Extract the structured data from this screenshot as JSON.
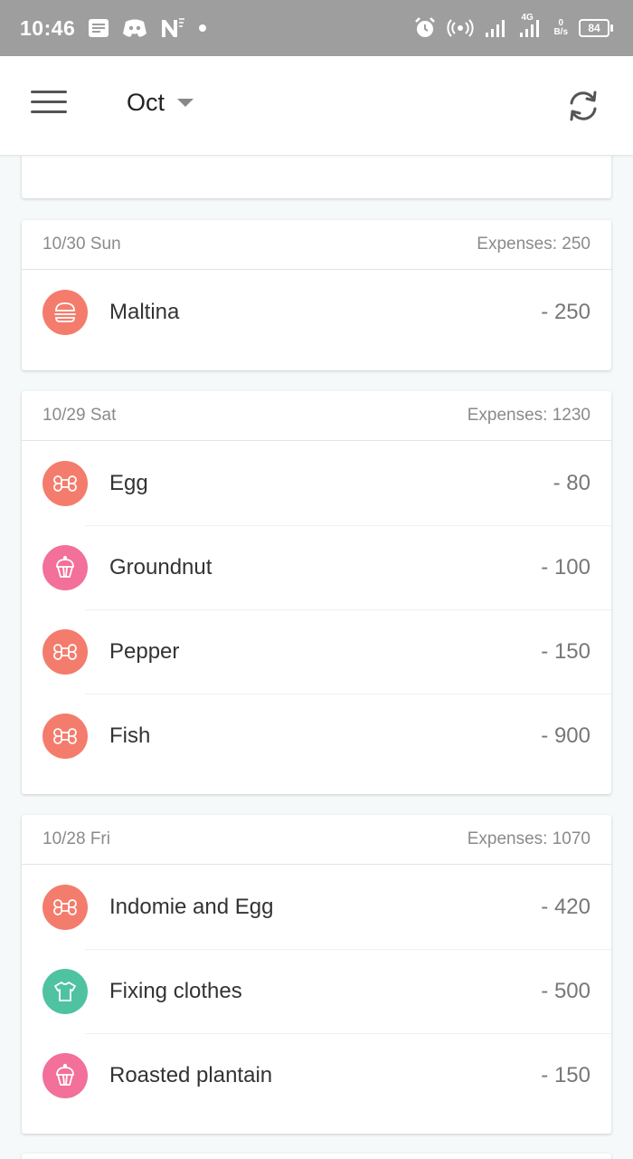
{
  "status_bar": {
    "time": "10:46",
    "network": "4G",
    "speed_value": "0",
    "speed_unit": "B/s",
    "battery": "84",
    "icons": [
      "notes-icon",
      "discord-icon",
      "n-app-icon",
      "dot-icon",
      "alarm-icon",
      "hotspot-icon",
      "signal-icon",
      "signal-4g-icon"
    ]
  },
  "header": {
    "month": "Oct",
    "menu_icon": "hamburger-menu-icon",
    "refresh_icon": "refresh-icon"
  },
  "colors": {
    "food": "#f47c6c",
    "snack": "#f2709a",
    "clothing": "#4fc3a1"
  },
  "days": [
    {
      "date": "10/30 Sun",
      "total": "Expenses: 250",
      "items": [
        {
          "name": "Maltina",
          "amount": "- 250",
          "icon": "burger-icon"
        }
      ]
    },
    {
      "date": "10/29 Sat",
      "total": "Expenses: 1230",
      "items": [
        {
          "name": "Egg",
          "amount": "- 80",
          "icon": "command-icon"
        },
        {
          "name": "Groundnut",
          "amount": "- 100",
          "icon": "cupcake-icon"
        },
        {
          "name": "Pepper",
          "amount": "- 150",
          "icon": "command-icon"
        },
        {
          "name": "Fish",
          "amount": "- 900",
          "icon": "command-icon"
        }
      ]
    },
    {
      "date": "10/28 Fri",
      "total": "Expenses: 1070",
      "items": [
        {
          "name": "Indomie and Egg",
          "amount": "- 420",
          "icon": "command-icon"
        },
        {
          "name": "Fixing clothes",
          "amount": "- 500",
          "icon": "tshirt-icon"
        },
        {
          "name": "Roasted plantain",
          "amount": "- 150",
          "icon": "cupcake-icon"
        }
      ]
    }
  ]
}
